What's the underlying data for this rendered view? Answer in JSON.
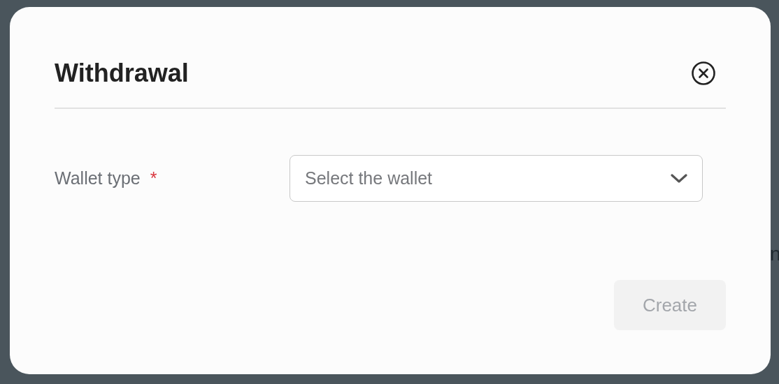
{
  "background_texts": [
    "n"
  ],
  "dialog": {
    "title": "Withdrawal",
    "fields": [
      {
        "label": "Wallet type",
        "required": true,
        "required_mark": "*",
        "placeholder": "Select the wallet"
      }
    ],
    "buttons": [
      {
        "label": "Create",
        "disabled": true
      }
    ]
  }
}
